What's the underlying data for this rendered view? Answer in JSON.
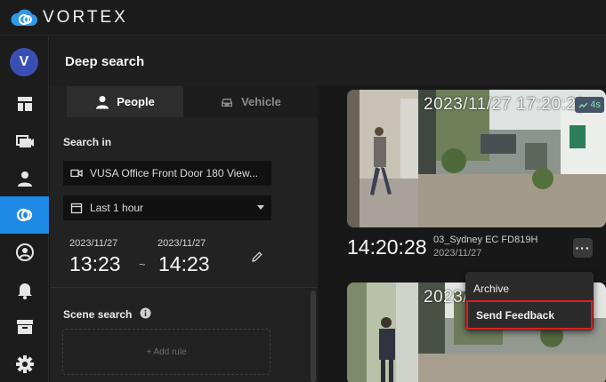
{
  "app": {
    "name": "VORTEX"
  },
  "user": {
    "initial": "V"
  },
  "header": {
    "title": "Deep search"
  },
  "tabs": [
    {
      "label": "People"
    },
    {
      "label": "Vehicle"
    }
  ],
  "search_in": {
    "label": "Search in",
    "camera_value": "VUSA Office Front Door 180 View...",
    "time_range_value": "Last 1 hour"
  },
  "range": {
    "start_date": "2023/11/27",
    "start_time": "13:23",
    "separator": "~",
    "end_date": "2023/11/27",
    "end_time": "14:23"
  },
  "scene_search": {
    "label": "Scene search",
    "add_rule_label": "+ Add rule"
  },
  "result1": {
    "overlay_timestamp": "2023/11/27 17:20:2(",
    "duration_badge": "4s",
    "time": "14:20:28",
    "camera": "03_Sydney EC FD819H",
    "date": "2023/11/27",
    "more_label": "···"
  },
  "result2": {
    "overlay_timestamp": "2023/11/2"
  },
  "menu": {
    "archive": "Archive",
    "send_feedback": "Send Feedback"
  },
  "colors": {
    "accent": "#1e88e5",
    "highlight": "#e01e1e",
    "badge_text": "#7fe0b2"
  }
}
